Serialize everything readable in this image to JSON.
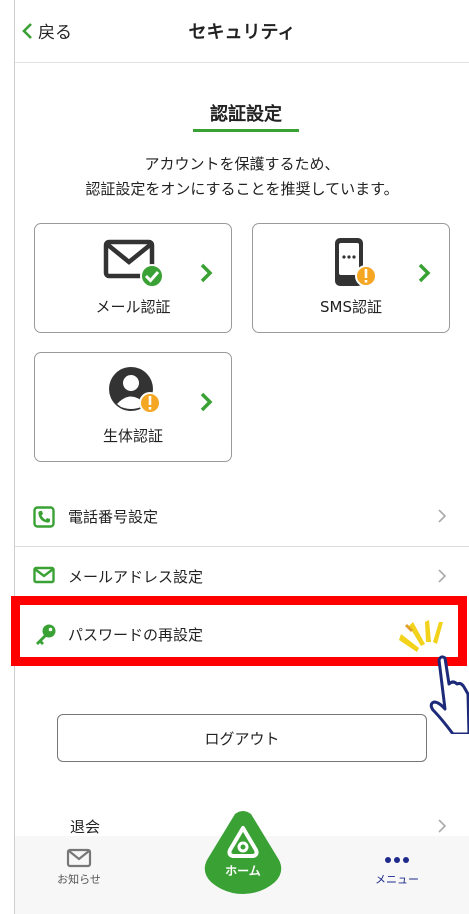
{
  "header": {
    "back_label": "戻る",
    "title": "セキュリティ"
  },
  "auth": {
    "section_title": "認証設定",
    "description_line1": "アカウントを保護するため、",
    "description_line2": "認証設定をオンにすることを推奨しています。",
    "cards": [
      {
        "label": "メール認証",
        "icon": "mail-icon",
        "status": "check"
      },
      {
        "label": "SMS認証",
        "icon": "phone-icon",
        "status": "warning"
      },
      {
        "label": "生体認証",
        "icon": "person-icon",
        "status": "warning"
      }
    ]
  },
  "settings": {
    "rows": [
      {
        "label": "電話番号設定",
        "icon": "phone-icon"
      },
      {
        "label": "メールアドレス設定",
        "icon": "mail-icon"
      },
      {
        "label": "パスワードの再設定",
        "icon": "key-icon"
      }
    ]
  },
  "logout_label": "ログアウト",
  "withdraw_label": "退会",
  "tabbar": {
    "notice_label": "お知らせ",
    "home_label": "ホーム",
    "menu_label": "メニュー"
  },
  "colors": {
    "accent": "#3aa135",
    "warning": "#f5a623",
    "highlight": "#ff0000",
    "pointer": "#1d2a7a"
  }
}
